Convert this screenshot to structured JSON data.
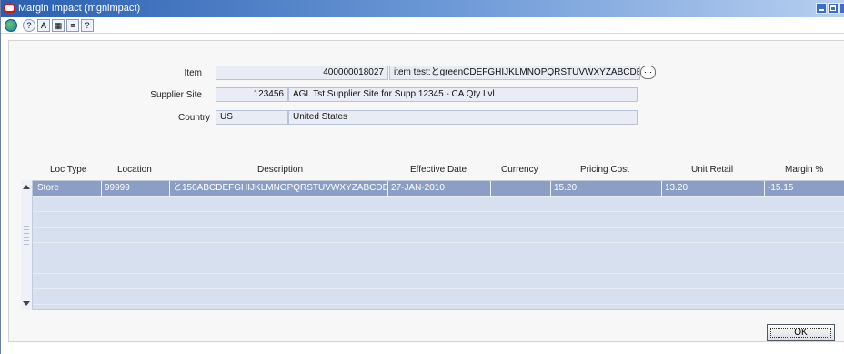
{
  "window": {
    "title": "Margin Impact",
    "subtitle": "(mgnimpact)"
  },
  "toolbar": {
    "icons": [
      "globe-icon",
      "help-icon",
      "text-icon",
      "calendar-icon",
      "notes-icon",
      "help-question-icon"
    ]
  },
  "form": {
    "item_label": "Item",
    "item_id": "400000018027",
    "item_desc": "item test:とgreenCDEFGHIJKLMNOPQRSTUVWXYZABCDE",
    "supplier_site_label": "Supplier Site",
    "supplier_site_id": "123456",
    "supplier_site_name": "AGL Tst Supplier Site for Supp 12345 - CA Qty Lvl",
    "country_label": "Country",
    "country_code": "US",
    "country_name": "United States"
  },
  "table": {
    "headers": {
      "loc_type": "Loc Type",
      "location": "Location",
      "description": "Description",
      "effective_date": "Effective Date",
      "currency": "Currency",
      "pricing_cost": "Pricing Cost",
      "unit_retail": "Unit Retail",
      "margin_pct": "Margin %"
    },
    "rows": [
      {
        "loc_type": "Store",
        "location": "99999",
        "description": "と150ABCDEFGHIJKLMNOPQRSTUVWXYZABCDEF",
        "effective_date": "27-JAN-2010",
        "currency": "",
        "pricing_cost": "15.20",
        "unit_retail": "13.20",
        "margin_pct": "-15.15"
      }
    ]
  },
  "buttons": {
    "ok": "OK"
  },
  "colors": {
    "title_bar": "#2a5fb0",
    "selected_row": "#8b9fc6",
    "empty_rows": "#d7e0ee"
  }
}
